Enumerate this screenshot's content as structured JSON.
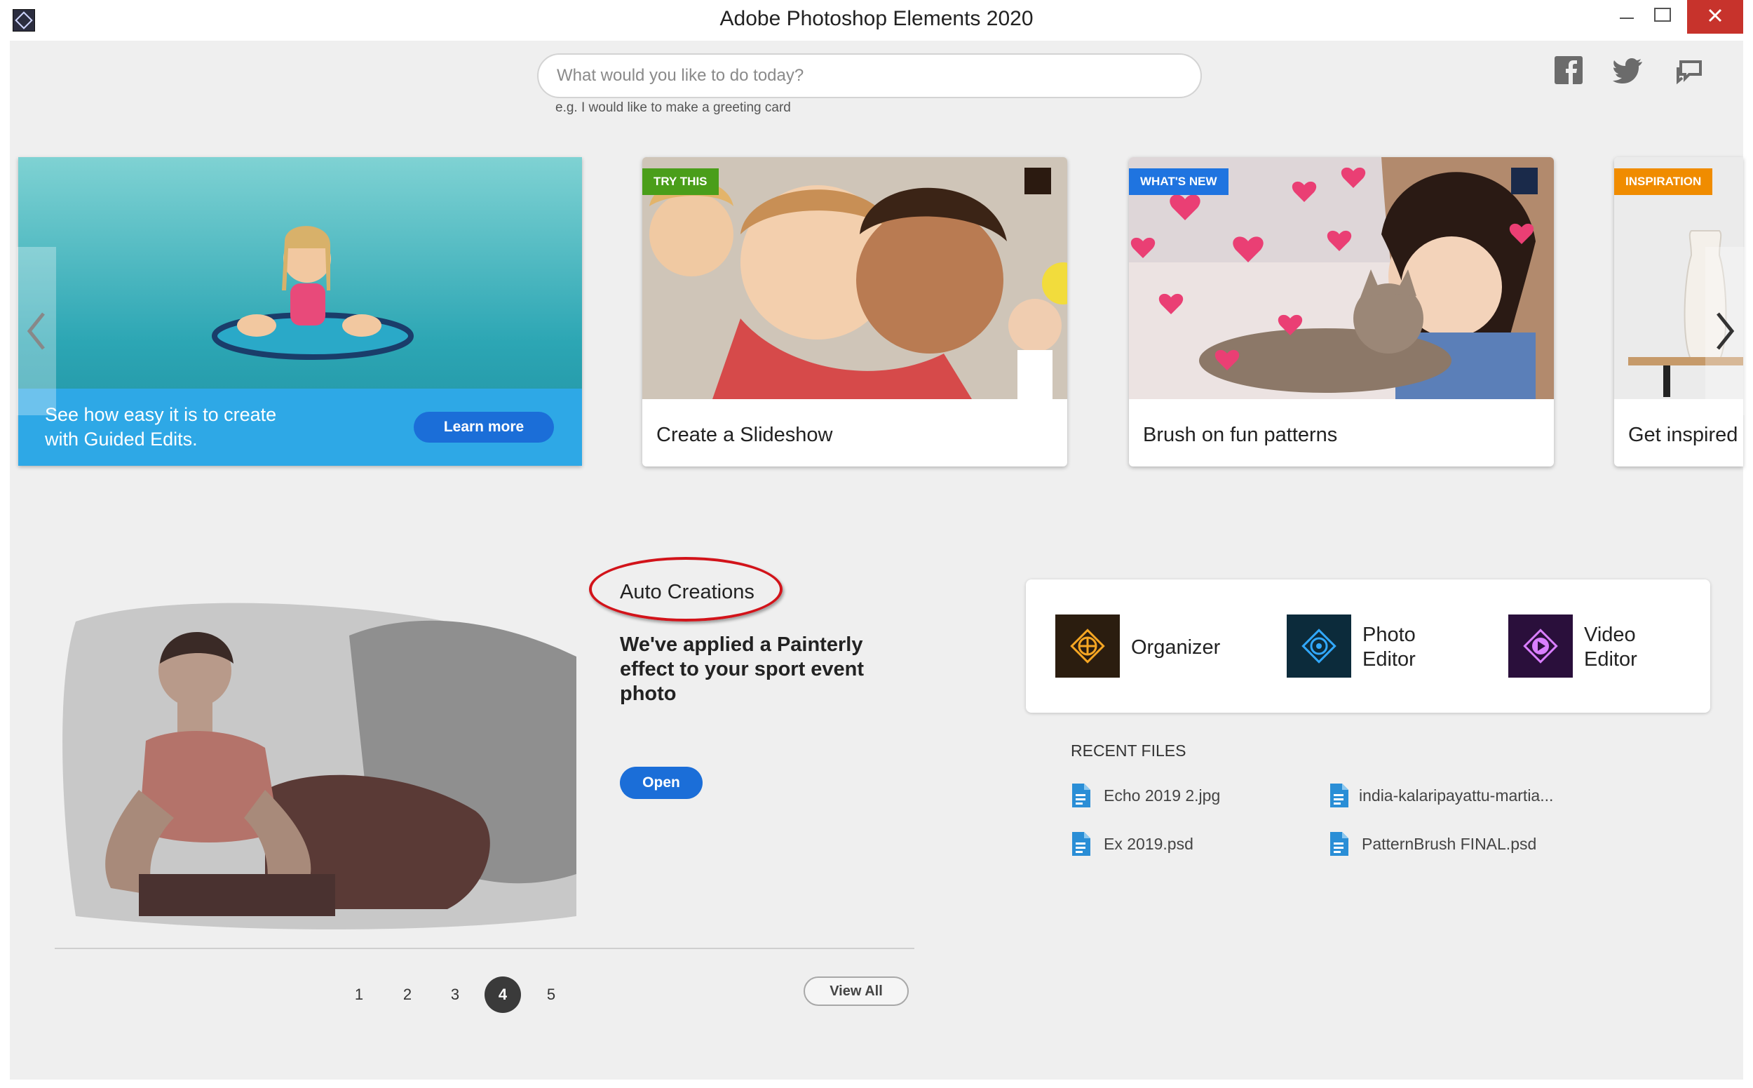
{
  "window": {
    "title": "Adobe Photoshop Elements 2020"
  },
  "search": {
    "placeholder": "What would you like to do today?",
    "value": "",
    "hint": "e.g. I would like to make a greeting card"
  },
  "social": [
    "facebook-icon",
    "twitter-icon",
    "feedback-icon"
  ],
  "hero": {
    "caption": "See how easy it is to create with Guided Edits.",
    "button": "Learn more"
  },
  "cards": [
    {
      "badge": "TRY THIS",
      "badge_color": "#4a9e1a",
      "label": "Create a Slideshow"
    },
    {
      "badge": "WHAT'S NEW",
      "badge_color": "#1f74e0",
      "label": "Brush on fun patterns"
    },
    {
      "badge": "INSPIRATION",
      "badge_color": "#f08c00",
      "label": "Get inspired d"
    }
  ],
  "auto_creations": {
    "title": "Auto Creations",
    "description": "We've applied a Painterly effect to your sport event photo",
    "button": "Open"
  },
  "pagination": {
    "pages": [
      "1",
      "2",
      "3",
      "4",
      "5"
    ],
    "active": "4",
    "view_all": "View All"
  },
  "launchers": [
    {
      "label": "Organizer",
      "color": "#f5a623"
    },
    {
      "label": "Photo Editor",
      "color": "#31a8ff"
    },
    {
      "label": "Video Editor",
      "color": "#d97eff"
    }
  ],
  "recent": {
    "title": "RECENT FILES",
    "files": [
      "Echo 2019 2.jpg",
      "india-kalaripayattu-martia...",
      "Ex 2019.psd",
      "PatternBrush FINAL.psd"
    ]
  }
}
